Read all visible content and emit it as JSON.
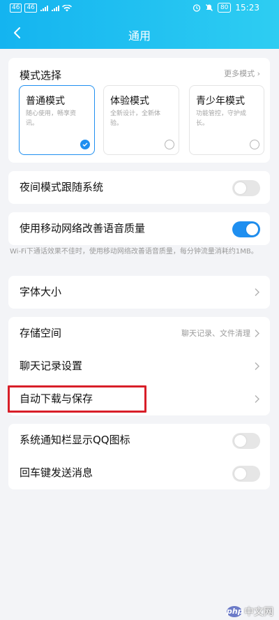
{
  "statusbar": {
    "left": "46 ᵢₗ ᵢₗ ≋",
    "battery": "80",
    "time": "15:23"
  },
  "header": {
    "title": "通用"
  },
  "mode": {
    "heading": "模式选择",
    "more": "更多模式 ›",
    "cards": [
      {
        "name": "普通模式",
        "desc": "随心使用，畅享资讯。",
        "selected": true
      },
      {
        "name": "体验模式",
        "desc": "全新设计，全新体验。",
        "selected": false
      },
      {
        "name": "青少年模式",
        "desc": "功能管控，守护成长。",
        "selected": false
      }
    ]
  },
  "night_mode": {
    "label": "夜间模式跟随系统",
    "on": false
  },
  "mobile_voice": {
    "label": "使用移动网络改善语音质量",
    "on": true
  },
  "mobile_voice_note": "Wi-Fi下通话效果不佳时，使用移动网络改善语音质量，每分钟流量消耗约1MB。",
  "font_size": {
    "label": "字体大小"
  },
  "storage": {
    "label": "存储空间",
    "right": "聊天记录、文件清理"
  },
  "chat_settings": {
    "label": "聊天记录设置"
  },
  "auto_download": {
    "label": "自动下载与保存"
  },
  "qq_icon": {
    "label": "系统通知栏显示QQ图标",
    "on": false
  },
  "enter_send": {
    "label": "回车键发送消息",
    "on": false
  },
  "watermark": {
    "logo": "php",
    "text": "中文网"
  },
  "colors": {
    "accent": "#1f8ff0",
    "header": "#14b4f0",
    "highlight": "#d81e28"
  }
}
